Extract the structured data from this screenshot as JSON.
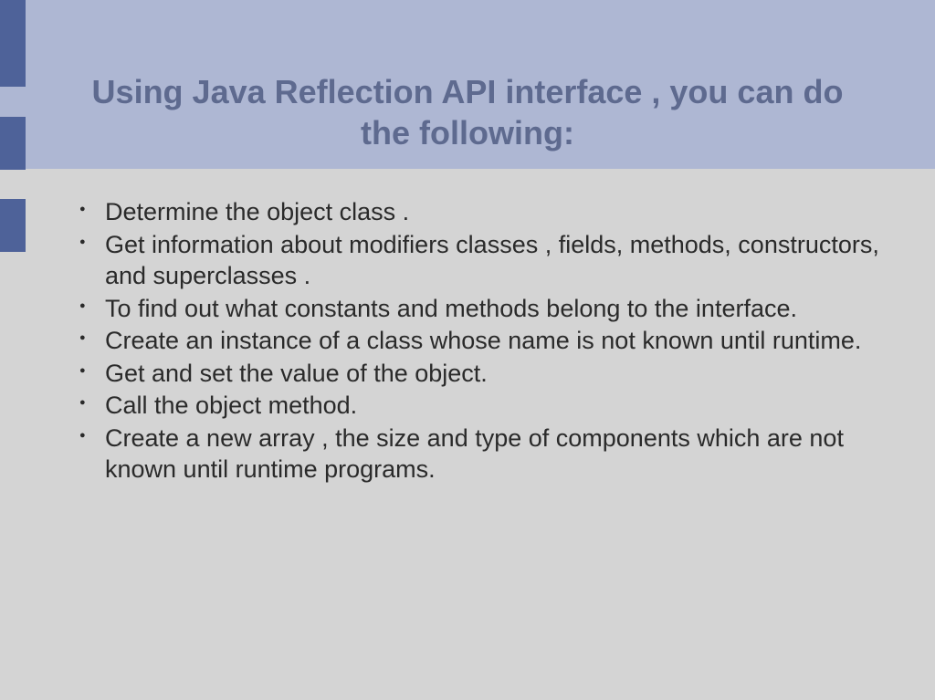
{
  "title": "Using Java Reflection API interface , you can do the following:",
  "bullets": [
    "Determine the object class .",
    "Get information about modifiers classes , fields, methods, constructors, and superclasses .",
    "To find out what constants and methods belong to the interface.",
    "Create an instance of a class whose name is not known until runtime.",
    "Get and set the value of the object.",
    "Call the object method.",
    "Create a new array , the size and type of components which are not known until runtime programs."
  ]
}
